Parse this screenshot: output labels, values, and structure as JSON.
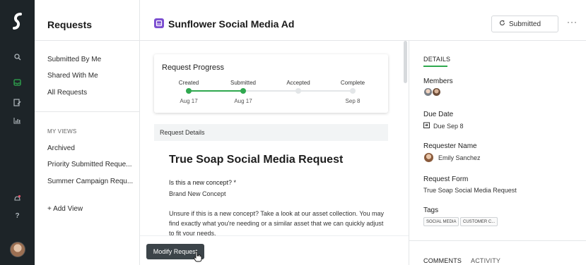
{
  "nav": {
    "title": "Requests",
    "items": [
      "Submitted By Me",
      "Shared With Me",
      "All Requests"
    ],
    "views_heading": "MY VIEWS",
    "views": [
      "Archived",
      "Priority Submitted Reque...",
      "Summer Campaign Requ..."
    ],
    "add_view": "+ Add View"
  },
  "header": {
    "title": "Sunflower Social Media Ad",
    "status": "Submitted",
    "more": "···"
  },
  "progress": {
    "title": "Request Progress",
    "stages": [
      {
        "label": "Created",
        "date": "Aug 17",
        "done": true
      },
      {
        "label": "Submitted",
        "date": "Aug 17",
        "done": true
      },
      {
        "label": "Accepted",
        "date": "",
        "done": false
      },
      {
        "label": "Complete",
        "date": "Sep 8",
        "done": false
      }
    ],
    "accent": "#2fa84f"
  },
  "request": {
    "section": "Request Details",
    "title": "True Soap Social Media Request",
    "question": "Is this a new concept? *",
    "answer": "Brand New Concept",
    "paragraph": "Unsure if this is a new concept? Take a look at our asset collection. You may find exactly what you're needing or a similar asset that we can quickly adjust to fit your needs.",
    "modify_button": "Modify Request"
  },
  "details": {
    "tab": "DETAILS",
    "members_label": "Members",
    "due_label": "Due Date",
    "due_value": "Due Sep 8",
    "requester_label": "Requester Name",
    "requester_value": "Emily Sanchez",
    "form_label": "Request Form",
    "form_value": "True Soap Social Media Request",
    "tags_label": "Tags",
    "tags": [
      "SOCIAL MEDIA",
      "CUSTOMER C..."
    ],
    "comments_tab": "COMMENTS",
    "activity_tab": "ACTIVITY"
  },
  "icons": {
    "logo": "logo-icon",
    "rail": [
      "search-icon",
      "inbox-icon",
      "edit-icon",
      "chart-icon",
      "bell-icon",
      "help-icon"
    ],
    "status": "refresh-icon",
    "due": "calendar-icon"
  }
}
